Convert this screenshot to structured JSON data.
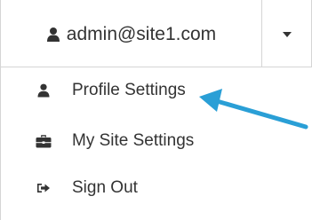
{
  "account_button": {
    "label": "admin@site1.com",
    "icon": "user-icon"
  },
  "dropdown_toggle": {
    "icon": "caret-down-icon"
  },
  "menu": {
    "items": [
      {
        "label": "Profile Settings",
        "icon": "user-icon"
      },
      {
        "label": "My Site Settings",
        "icon": "briefcase-icon"
      },
      {
        "label": "Sign Out",
        "icon": "sign-out-icon"
      }
    ]
  },
  "annotation": {
    "color": "#2a9fd6",
    "icon": "arrow-pointer"
  }
}
